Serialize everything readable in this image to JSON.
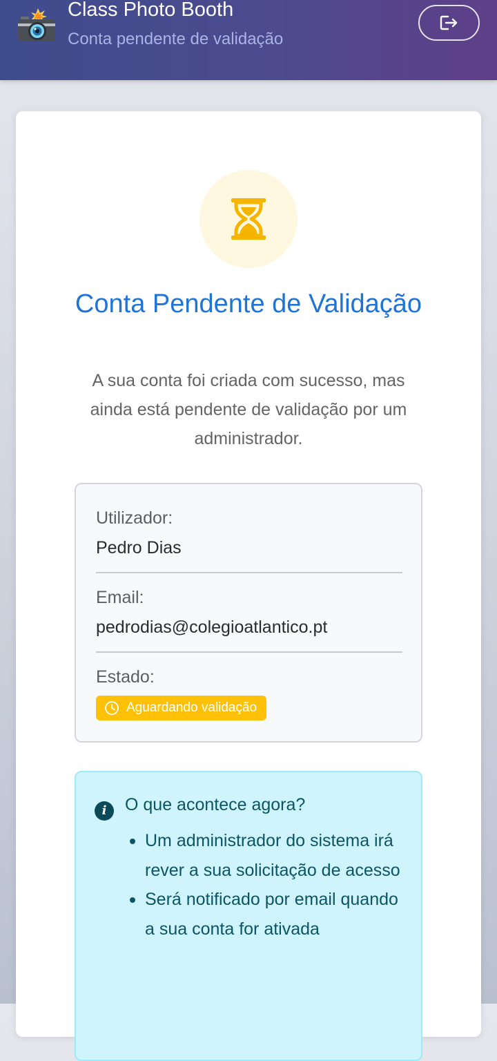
{
  "header": {
    "camera_icon": "camera-flash-icon",
    "app_title": "Class Photo Booth",
    "app_subtitle": "Conta pendente de validação",
    "logout_icon": "logout-icon"
  },
  "card": {
    "status_icon": "hourglass-icon",
    "title": "Conta Pendente de Validação",
    "description": "A sua conta foi criada com sucesso, mas ainda está pendente de validação por um administrador.",
    "account": {
      "user_label": "Utilizador:",
      "user_value": "Pedro Dias",
      "email_label": "Email:",
      "email_value": "pedrodias@colegioatlantico.pt",
      "status_label": "Estado:",
      "status_badge": "Aguardando validação",
      "status_icon": "clock-icon"
    },
    "next_steps": {
      "icon": "info-icon",
      "heading": "O que acontece agora?",
      "items": [
        "Um administrador do sistema irá rever a sua solicitação de acesso",
        "Será notificado por email quando a sua conta for ativada"
      ]
    }
  },
  "colors": {
    "header_gradient_start": "#3e4c8d",
    "header_gradient_end": "#5e3f88",
    "title": "#1f74d6",
    "badge": "#ffc107",
    "hourglass": "#f5b400",
    "info_bg": "#cff4fc",
    "info_text": "#0b5566"
  }
}
